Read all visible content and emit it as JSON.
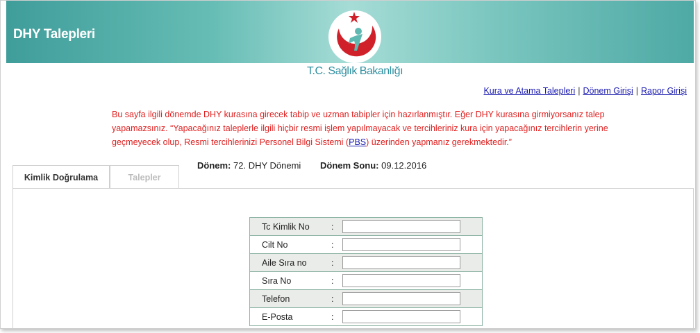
{
  "header": {
    "title": "DHY Talepleri",
    "ministry": "T.C. Sağlık Bakanlığı",
    "colors": {
      "brand_teal": "#3f9d9a",
      "logo_red": "#d0202a"
    }
  },
  "toplinks": [
    {
      "label": "Kura ve Atama Talepleri"
    },
    {
      "label": "Dönem Girişi"
    },
    {
      "label": "Rapor Girişi"
    }
  ],
  "separator": "|",
  "notice": {
    "text_before": "Bu sayfa ilgili dönemde DHY kurasına girecek tabip ve uzman tabipler için hazırlanmıştır. Eğer DHY kurasına girmiyorsanız talep yapamazsınız. “Yapacağınız taleplerle ilgili hiçbir resmi işlem yapılmayacak ve tercihleriniz kura için yapacağınız tercihlerin yerine geçmeyecek olup, Resmi tercihlerinizi Personel Bilgi Sistemi (",
    "link": "PBS",
    "text_after": ") üzerinden yapmanız gerekmektedir.”"
  },
  "period": {
    "donem_label": "Dönem:",
    "donem_value": "72. DHY Dönemi",
    "sonu_label": "Dönem Sonu:",
    "sonu_value": "09.12.2016"
  },
  "tabs": [
    {
      "label": "Kimlik Doğrulama",
      "active": true
    },
    {
      "label": "Talepler",
      "active": false
    }
  ],
  "form": {
    "colon": ":",
    "fields": [
      {
        "label": "Tc Kimlik No",
        "value": ""
      },
      {
        "label": "Cilt No",
        "value": ""
      },
      {
        "label": "Aile Sıra no",
        "value": ""
      },
      {
        "label": "Sıra No",
        "value": ""
      },
      {
        "label": "Telefon",
        "value": ""
      },
      {
        "label": "E-Posta",
        "value": ""
      }
    ]
  }
}
